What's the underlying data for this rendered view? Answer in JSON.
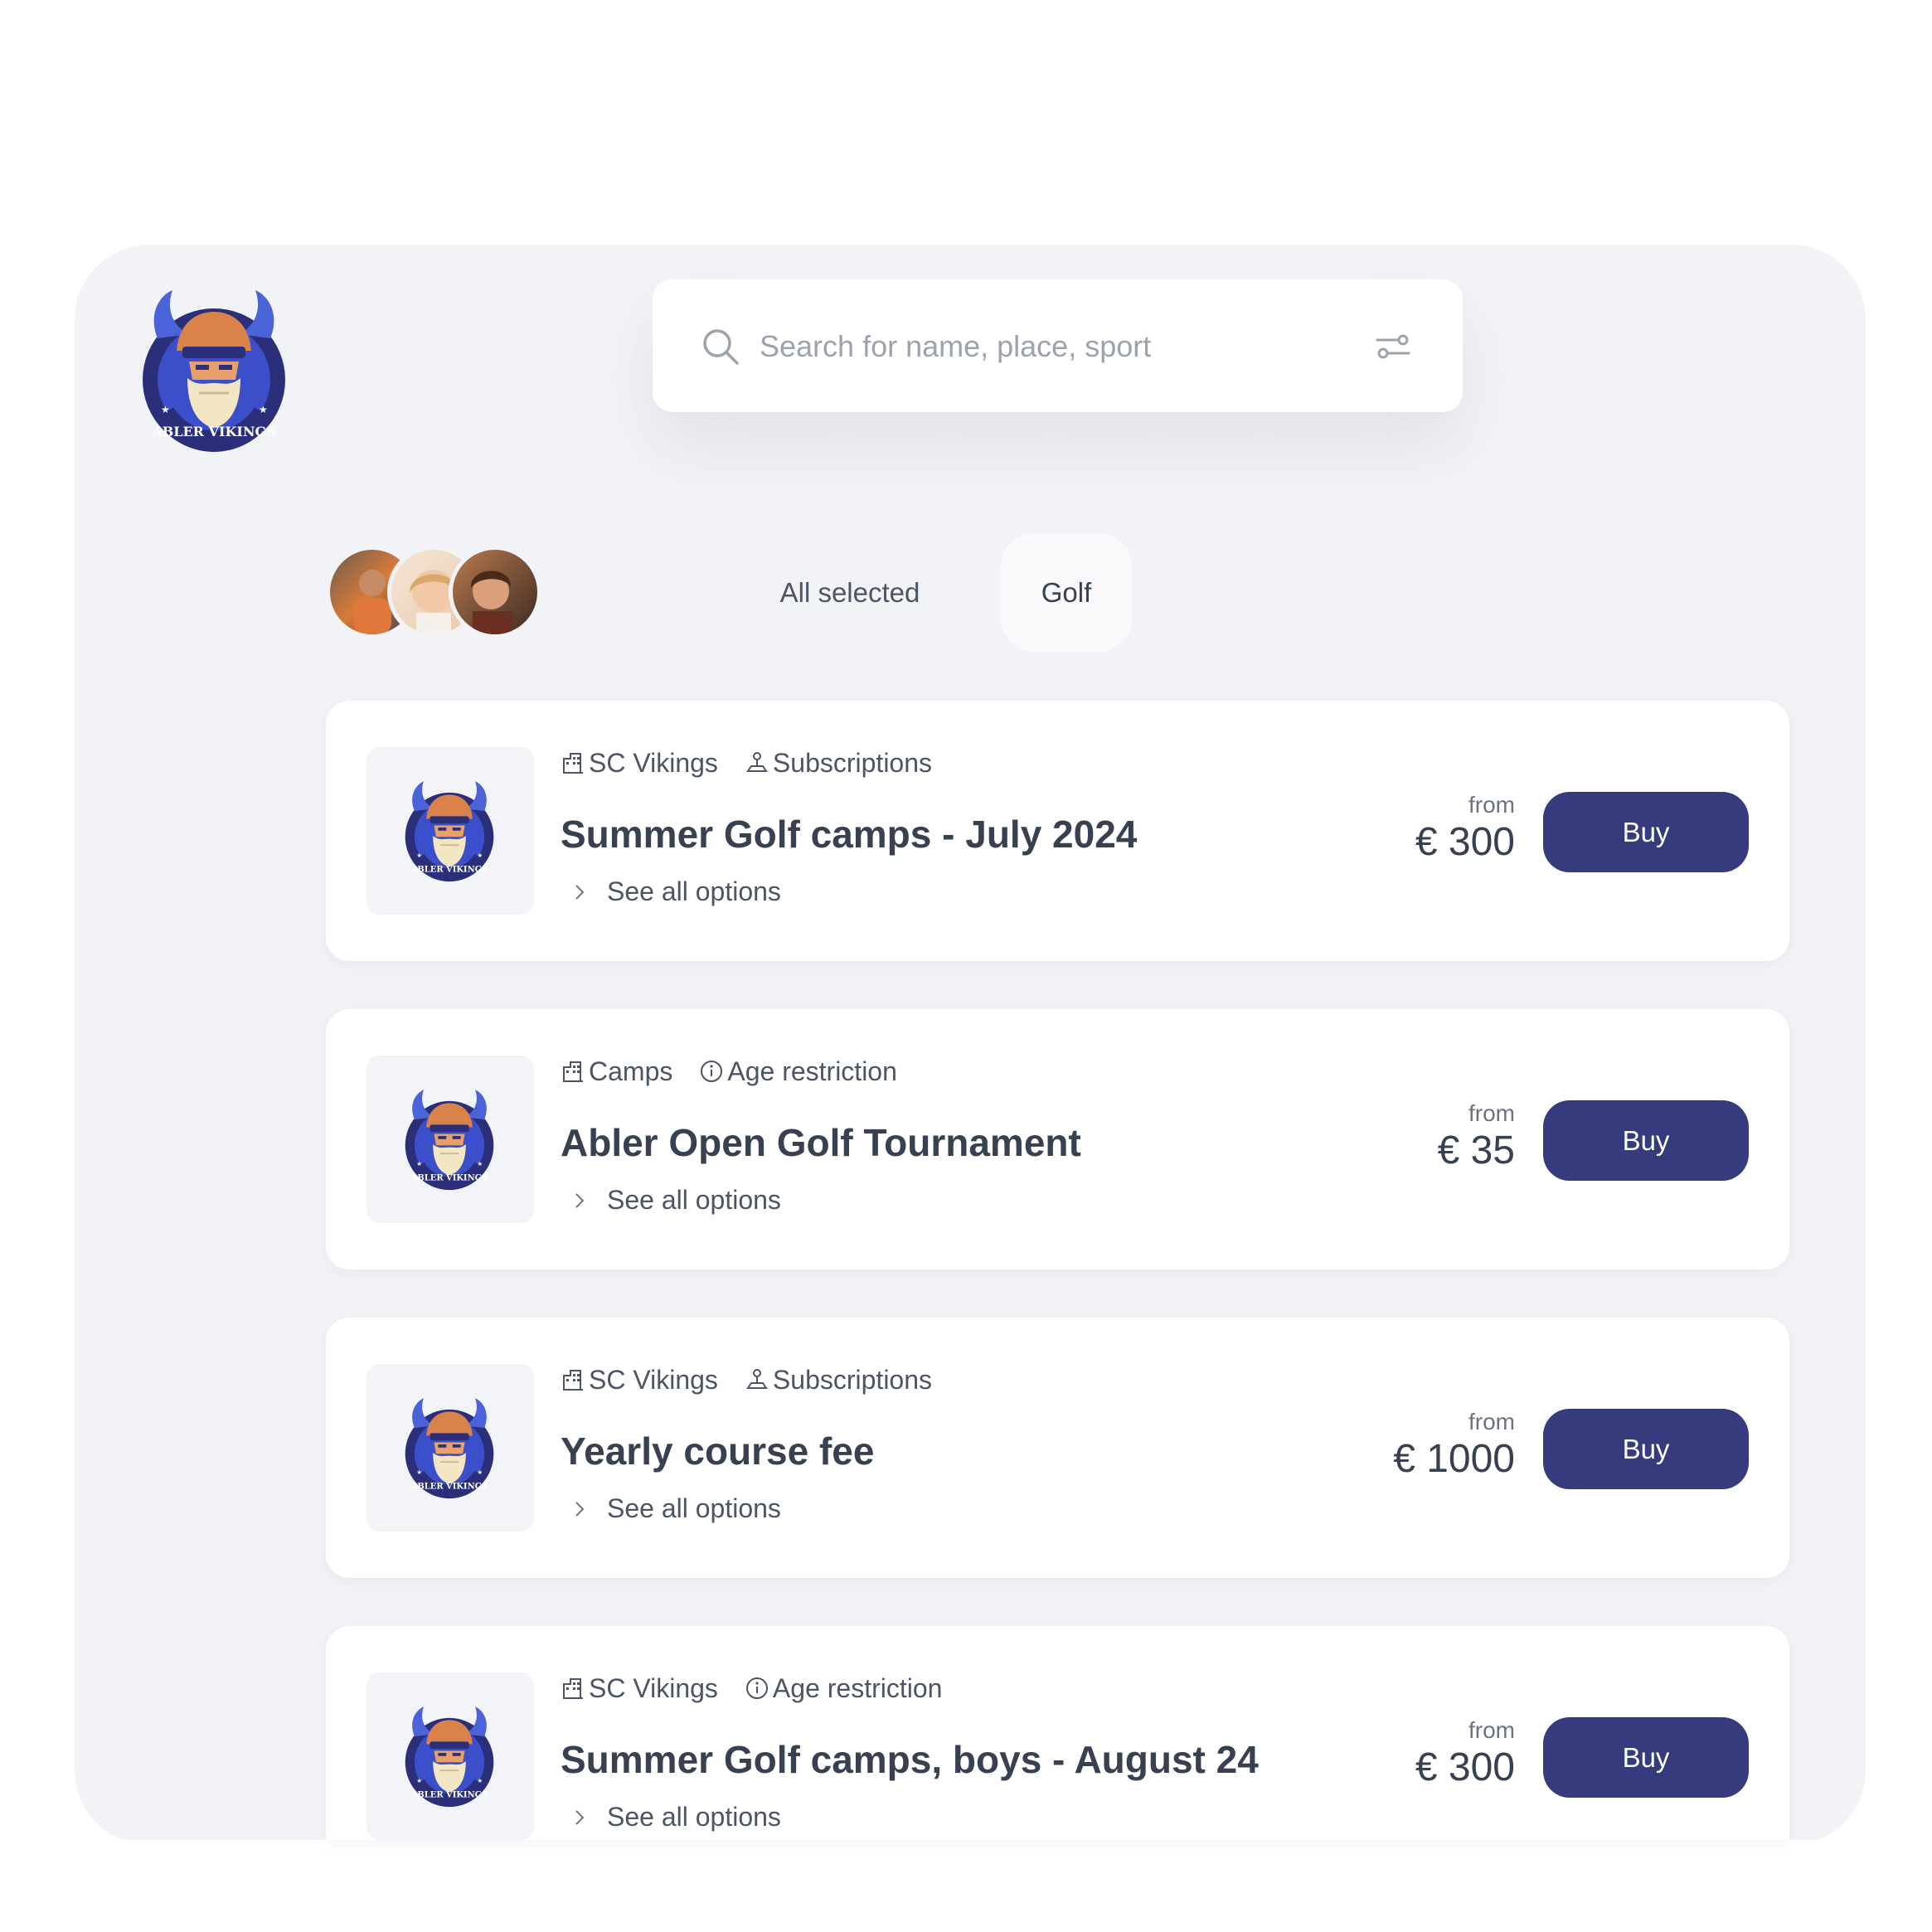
{
  "brand": {
    "logo_text": "ABLER VIKINGS",
    "colors": {
      "navy": "#353b7c",
      "panel_bg": "#f2f3f7",
      "logo_blue": "#3a4fc9",
      "logo_orange": "#d9834a"
    }
  },
  "search": {
    "placeholder": "Search for name, place, sport",
    "value": "",
    "icon": "search-icon",
    "filter_icon": "sliders-icon"
  },
  "filters": {
    "all_label": "All selected",
    "active_chip": "Golf"
  },
  "listings": [
    {
      "club": "SC Vikings",
      "club_icon": "building-icon",
      "tag": "Subscriptions",
      "tag_icon": "joystick-icon",
      "title": "Summer Golf camps - July 2024",
      "link": "See all options",
      "from_label": "from",
      "price": "€ 300",
      "button": "Buy"
    },
    {
      "club": "Camps",
      "club_icon": "building-icon",
      "tag": "Age restriction",
      "tag_icon": "info-icon",
      "title": "Abler Open Golf Tournament",
      "link": "See all options",
      "from_label": "from",
      "price": "€ 35",
      "button": "Buy"
    },
    {
      "club": "SC Vikings",
      "club_icon": "building-icon",
      "tag": "Subscriptions",
      "tag_icon": "joystick-icon",
      "title": "Yearly course fee",
      "link": "See all options",
      "from_label": "from",
      "price": "€ 1000",
      "button": "Buy"
    },
    {
      "club": "SC Vikings",
      "club_icon": "building-icon",
      "tag": "Age restriction",
      "tag_icon": "info-icon",
      "title": "Summer Golf camps, boys - August 24",
      "link": "See all options",
      "from_label": "from",
      "price": "€ 300",
      "button": "Buy"
    }
  ]
}
